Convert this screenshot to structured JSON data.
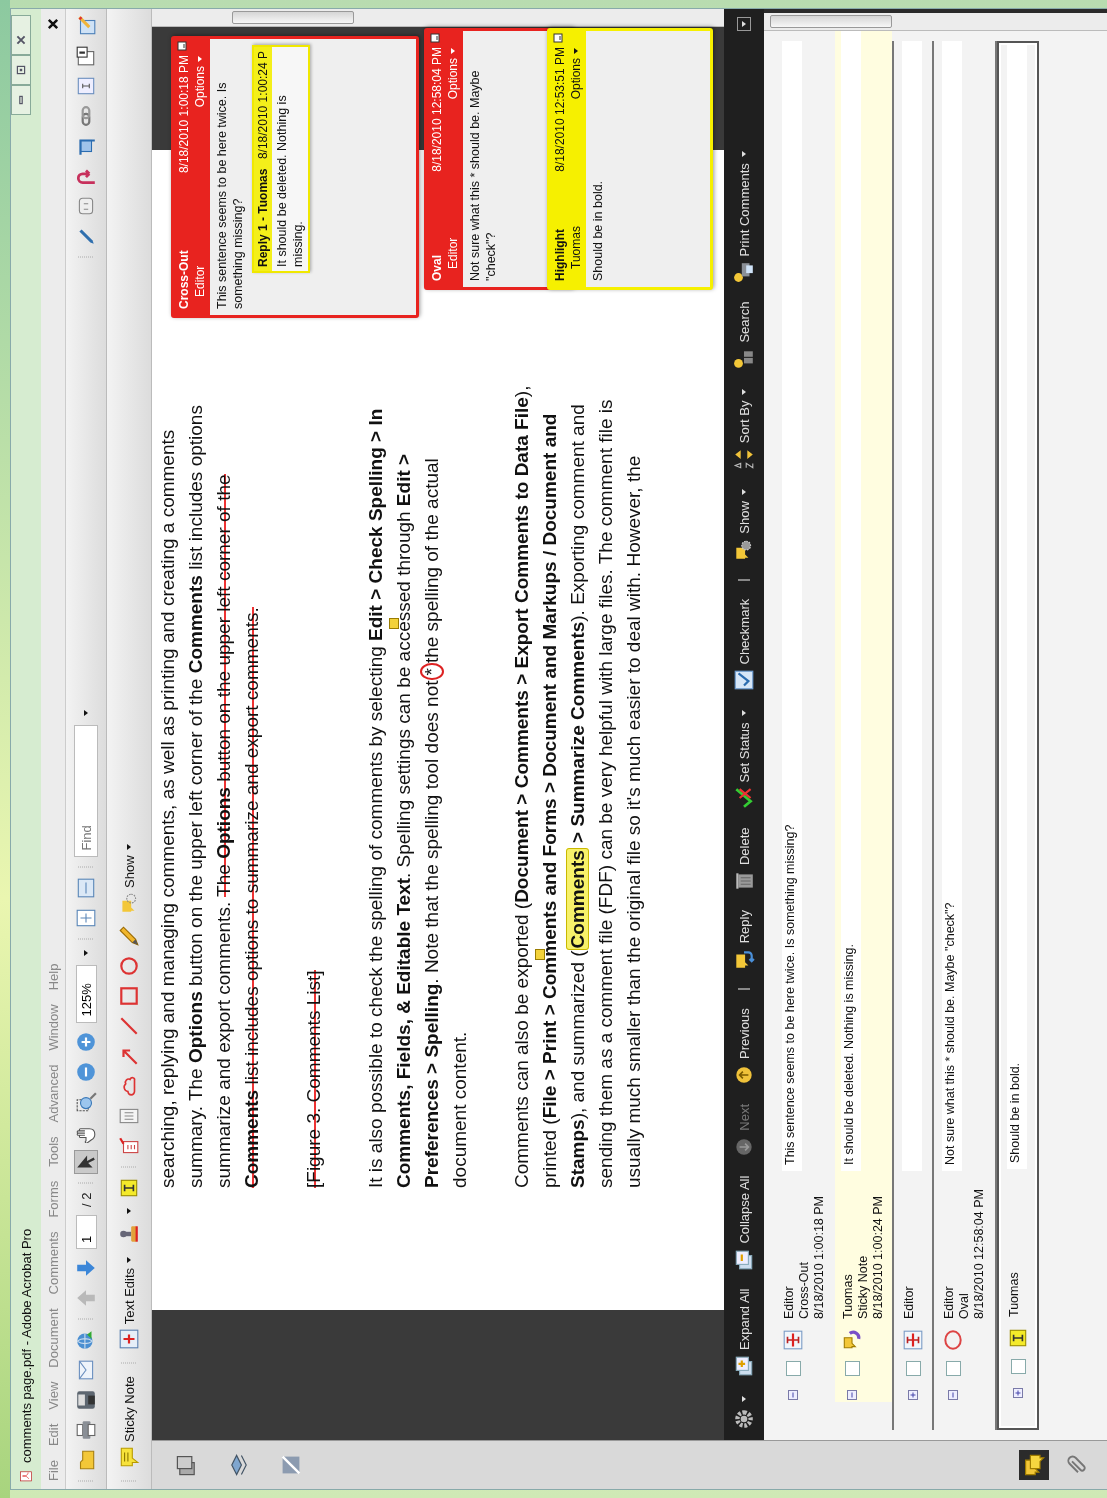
{
  "window": {
    "title": "comments page.pdf - Adobe Acrobat Pro"
  },
  "menu": [
    "File",
    "Edit",
    "View",
    "Document",
    "Comments",
    "Forms",
    "Tools",
    "Advanced",
    "Window",
    "Help"
  ],
  "toolbar": {
    "page_number": "1",
    "page_count": "/ 2",
    "zoom": "125%",
    "find_placeholder": "Find",
    "tools": [
      {
        "selected": true
      },
      {
        "selected": false
      },
      {
        "selected": false
      }
    ]
  },
  "comment_tools": {
    "sticky_note": "Sticky Note",
    "text_edits": "Text Edits",
    "show": "Show"
  },
  "navigation": [
    {
      "selected": false
    },
    {
      "selected": false
    },
    {
      "selected": false
    },
    {
      "selected": true
    },
    {
      "selected": false
    }
  ],
  "document": {
    "paragraphs": [
      {
        "lines": [
          [
            {
              "kind": "plain",
              "text": "searching, replying and managing comments, as well as printing and creating a comments"
            }
          ],
          [
            {
              "kind": "plain",
              "text": "summary. The **Options** button on the upper left corner of the **Comments** list includes options"
            }
          ],
          [
            {
              "kind": "plain",
              "text": "summarize and export comments. "
            },
            {
              "kind": "struck",
              "text": "The **Options** button on the upper left corner of the"
            }
          ],
          [
            {
              "kind": "struck",
              "text": "**Comments** list includes options to summarize and export comments."
            }
          ]
        ]
      },
      {
        "lines": [
          [
            {
              "kind": "struck",
              "text": "[Figure 3. Comments List]"
            }
          ]
        ]
      },
      {
        "lines": [
          [
            {
              "kind": "plain",
              "text": "It is also possible to check the spelling of comments by selecting **Edit > Check Spelling > In**"
            }
          ],
          [
            {
              "kind": "plain",
              "text": "**Comments, Fields, & Editable Text**. Spelling settings can be "
            },
            {
              "kind": "note",
              "text": "accessed"
            },
            {
              "kind": "plain",
              "text": " through **Edit >**"
            }
          ],
          [
            {
              "kind": "plain",
              "text": "**Preferences > Spelling**. Note that the spelling tool does not"
            },
            {
              "kind": "oval",
              "text": "*"
            },
            {
              "kind": "plain",
              "text": "the spelling of the actual"
            }
          ],
          [
            {
              "kind": "plain",
              "text": "document content."
            }
          ]
        ]
      },
      {
        "lines": [
          [
            {
              "kind": "plain",
              "text": "Comments can also be exported (**Document > Comments > Export Comments to Data File**),"
            }
          ],
          [
            {
              "kind": "plain",
              "text": "printed (**File > Print >** "
            },
            {
              "kind": "note",
              "text": "**Comments**"
            },
            {
              "kind": "plain",
              "text": " **and Forms > Document and Markups / Document and**"
            }
          ],
          [
            {
              "kind": "plain",
              "text": "**Stamps**), and summarized ("
            },
            {
              "kind": "highlight",
              "text": "**Comments**"
            },
            {
              "kind": "plain",
              "text": " **> Summarize Comments**). Exporting comment and"
            }
          ],
          [
            {
              "kind": "plain",
              "text": "sending them as a comment file (FDF) can be very helpful with large files. The comment file is"
            }
          ],
          [
            {
              "kind": "plain",
              "text": "usually much smaller than the original file so it's much easier to deal with. However, the"
            }
          ]
        ]
      }
    ]
  },
  "popups": [
    {
      "type": "Cross-Out",
      "author": "Editor",
      "date": "8/18/2010 1:00:18 PM",
      "options": "Options",
      "color": "#e8231f",
      "text": "This sentence seems to be here twice. Is something missing?",
      "replies": [
        {
          "title": "Reply 1 - Tuomas",
          "date": "8/18/2010 1:00:24 P",
          "text": "It should be deleted. Nothing is missing."
        }
      ]
    },
    {
      "type": "Oval",
      "author": "Editor",
      "date": "8/18/2010 12:58:04 PM",
      "options": "Options",
      "color": "#e8231f",
      "text": "Not sure what this * should be. Maybe \"check\"?"
    },
    {
      "type": "Highlight",
      "author": "Tuomas",
      "date": "8/18/2010 12:53:51 PM",
      "options": "Options",
      "color": "#f6f000",
      "text": "Should be in bold."
    }
  ],
  "comments_panel": {
    "toolbar": [
      {
        "kind": "button",
        "label": "Expand All",
        "disabled": false
      },
      {
        "kind": "button",
        "label": "Collapse All",
        "disabled": false
      },
      {
        "kind": "button",
        "label": "Next",
        "disabled": true
      },
      {
        "kind": "button",
        "label": "Previous",
        "disabled": false
      },
      {
        "kind": "separator"
      },
      {
        "kind": "button",
        "label": "Reply",
        "disabled": false
      },
      {
        "kind": "button",
        "label": "Delete",
        "disabled": false
      },
      {
        "kind": "menu",
        "label": "Set Status",
        "disabled": false
      },
      {
        "kind": "button",
        "label": "Checkmark",
        "disabled": false
      },
      {
        "kind": "separator"
      },
      {
        "kind": "menu",
        "label": "Show",
        "disabled": false
      },
      {
        "kind": "menu",
        "label": "Sort By",
        "disabled": false
      },
      {
        "kind": "button",
        "label": "Search",
        "disabled": false
      },
      {
        "kind": "menu",
        "label": "Print Comments",
        "disabled": false
      }
    ],
    "rows": [
      {
        "kind": "cross-out",
        "author": "Editor",
        "type": "Cross-Out",
        "date": "8/18/2010 1:00:18 PM",
        "text": "This sentence seems to be here twice. Is something missing?",
        "expanded": true,
        "checked": false,
        "selected": false,
        "children": [
          {
            "kind": "sticky-note",
            "author": "Tuomas",
            "type": "Sticky Note",
            "date": "8/18/2010 1:00:24 PM",
            "text": "It should be deleted. Nothing is missing.",
            "expanded": true,
            "checked": false,
            "selected": false
          }
        ]
      },
      {
        "kind": "cross-out",
        "author": "Editor",
        "expanded": false,
        "checked": false,
        "selected": false
      },
      {
        "kind": "oval",
        "author": "Editor",
        "type": "Oval",
        "date": "8/18/2010 12:58:04 PM",
        "text": "Not sure what this * should be. Maybe \"check\"?",
        "expanded": true,
        "checked": false,
        "selected": false
      },
      {
        "kind": "highlight",
        "author": "Tuomas",
        "text": "Should be in bold.",
        "expanded": false,
        "checked": false,
        "selected": true
      }
    ]
  }
}
